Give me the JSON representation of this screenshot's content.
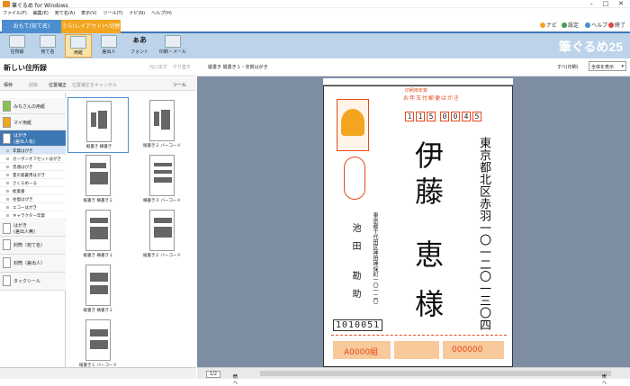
{
  "app": {
    "title": "筆ぐるめ for Windows",
    "brand": "筆ぐるめ25"
  },
  "menu": [
    "ファイル(F)",
    "編集(E)",
    "宛て名(A)",
    "表示(V)",
    "ツール(T)",
    "ナビ(N)",
    "ヘルプ(H)"
  ],
  "mode_tabs": {
    "front": "おもて(宛て名)",
    "back": "うら(レイアウト)へ切替"
  },
  "top_right": {
    "navi": "ナビ",
    "settings": "設定",
    "help": "ヘルプ",
    "exit": "終了"
  },
  "ribbon": [
    "住所録",
    "宛て名",
    "用紙",
    "差出人",
    "フォント",
    "印刷・メール"
  ],
  "left_panel": {
    "title": "新しい住所録",
    "undo": "元に戻す",
    "redo": "やり直す",
    "toolbar": {
      "save": "保存",
      "delete": "削除",
      "fix": "位置補正",
      "cancel_fix": "位置補正をキャンセル",
      "tools": "ツール"
    },
    "categories": [
      {
        "label": "みなさんの用紙"
      },
      {
        "label": "マイ用紙"
      },
      {
        "label": "はがき\n(差出人有)"
      },
      {
        "label": "はがき\n(差出人無)"
      },
      {
        "label": "封筒（宛て名）"
      },
      {
        "label": "封筒（差出人）"
      },
      {
        "label": "タックシール"
      }
    ],
    "subcats": [
      "年賀はがき",
      "カーボンオフセットはがき",
      "普通はがき",
      "夏の発暑用はがき",
      "さくらめーる",
      "絵葉書",
      "往復はがき",
      "エコーはがき",
      "キャラクター年賀"
    ],
    "thumbs": [
      "縦書き 横書き",
      "縦書き２ バーコード",
      "縦書き 横書き２",
      "横書き３ バーコード",
      "縦書き 横書き１",
      "縦書き２ バーコード",
      "縦書き 横書き２",
      "縦書き１ バーコード"
    ]
  },
  "right_panel": {
    "layout_label": "縦書き 縦書き１・年賀はがき",
    "show_label": "すべ(印刷)",
    "select_value": "全体を表示"
  },
  "postcard": {
    "stamp_label": "印刷用年賀",
    "stamp_text": "お年玉付郵便はがき",
    "postal_to": [
      "1",
      "1",
      "5",
      "0",
      "0",
      "4",
      "5"
    ],
    "address": [
      "東京都北区赤羽一〇一二〇一三〇四"
    ],
    "name_family": "伊藤",
    "name_given": "恵",
    "honorific": "様",
    "sender_address": "東京都千代田区神田神保町一〇一二〇",
    "sender_name": "池田 勘助",
    "postal_from": "1010051",
    "lottery": [
      "A0000組",
      "000000"
    ],
    "footer_note": "年賀はがき"
  },
  "status": {
    "page": "1/2",
    "prev": "前へ",
    "next": "次へ"
  },
  "colors": {
    "accent": "#3e78b4",
    "orange": "#f3a51f",
    "stamp": "#e6491b"
  }
}
